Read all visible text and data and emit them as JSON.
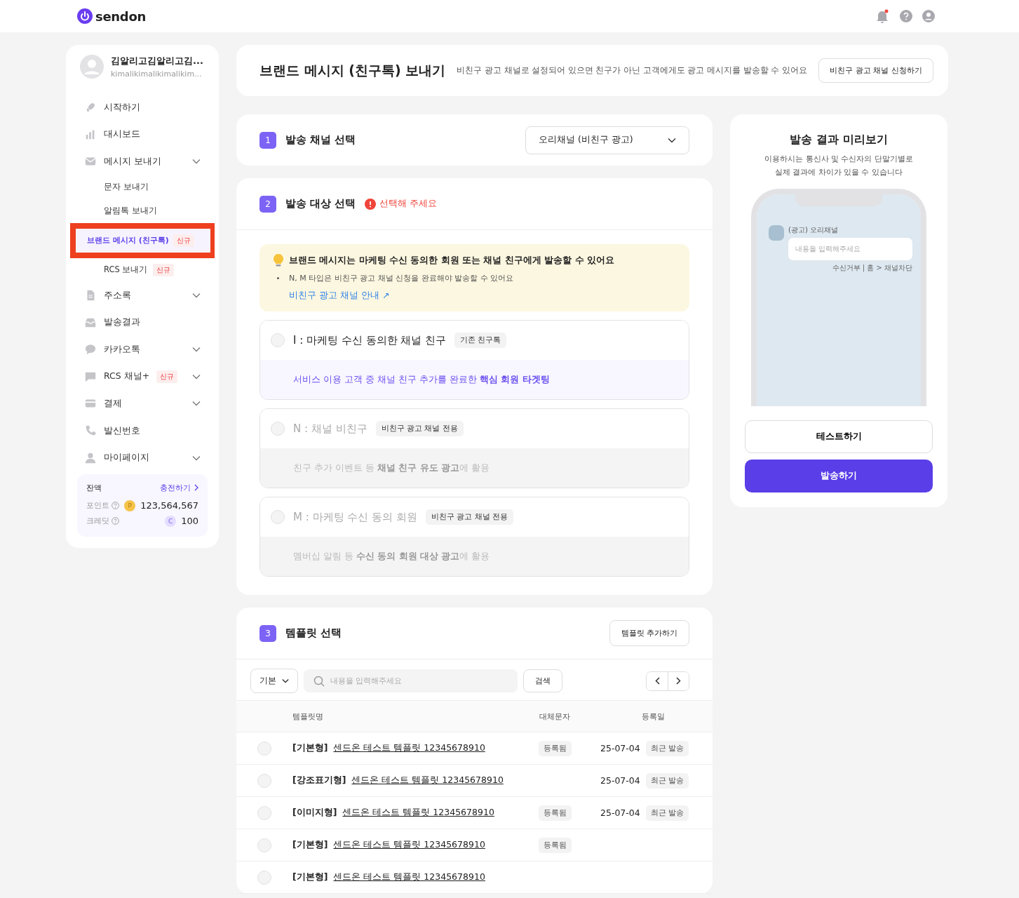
{
  "header": {
    "logo": "sendon",
    "has_notification": true
  },
  "sidebar": {
    "user": {
      "name": "김알리고김알리고김...",
      "email": "kimalikimalikimalikim..."
    },
    "nav": [
      {
        "label": "시작하기",
        "expandable": false,
        "selected": false
      },
      {
        "label": "대시보드",
        "expandable": false,
        "selected": false
      },
      {
        "label": "메시지 보내기",
        "expandable": true,
        "selected": false,
        "children": [
          {
            "label": "문자 보내기",
            "selected": false,
            "highlighted": false
          },
          {
            "label": "알림톡 보내기",
            "selected": false,
            "highlighted": false
          },
          {
            "label": "브랜드 메시지 (친구톡)",
            "badge": "신규",
            "selected": true,
            "highlighted": true
          },
          {
            "label": "RCS 보내기",
            "badge": "신규",
            "selected": false,
            "highlighted": false
          }
        ]
      },
      {
        "label": "주소록",
        "expandable": true,
        "selected": false
      },
      {
        "label": "발송결과",
        "expandable": false,
        "selected": false
      },
      {
        "label": "카카오톡",
        "expandable": true,
        "selected": false
      },
      {
        "label": "RCS 채널+",
        "badge": "신규",
        "expandable": true,
        "selected": false
      },
      {
        "label": "결제",
        "expandable": true,
        "selected": false
      },
      {
        "label": "발신번호",
        "expandable": false,
        "selected": false
      },
      {
        "label": "마이페이지",
        "expandable": true,
        "selected": false
      }
    ],
    "balance": {
      "title": "잔액",
      "charge_link": "충전하기",
      "rows": [
        {
          "label": "포인트",
          "coin": "P",
          "value": "123,564,567",
          "kind": "point"
        },
        {
          "label": "크레딧",
          "coin": "C",
          "value": "100",
          "kind": "credit"
        }
      ]
    }
  },
  "title_card": {
    "title": "브랜드 메시지 (친구톡) 보내기",
    "description": "비친구 광고 채널로 설정되어 있으면 친구가 아닌 고객에게도 광고 메시지를 발송할 수 있어요",
    "button": "비친구 광고 채널 신청하기"
  },
  "step1": {
    "number": "1",
    "title": "발송 채널 선택",
    "dropdown": "오리채널 (비친구 광고)"
  },
  "step2": {
    "number": "2",
    "title": "발송 대상 선택",
    "error": "선택해 주세요",
    "notice": {
      "title": "브랜드 메시지는 마케팅 수신 동의한 회원 또는 채널 친구에게 발송할 수 있어요",
      "bullets": [
        "N, M 타입은 비친구 광고 채널 신청을 완료해야 발송할 수 있어요"
      ],
      "link": "비친구 광고 채널 안내 ↗"
    },
    "options": [
      {
        "title": "I : 마케팅 수신 동의한 채널 친구",
        "tag": "기존 친구톡",
        "description": "서비스 이용 고객 중 채널 친구 추가를 완료한  **핵심 회원 타겟팅**",
        "disabled": false,
        "selected": false
      },
      {
        "title": "N : 채널 비친구",
        "tag": "비친구 광고 채널 전용",
        "description": "친구 추가 이벤트 등 **채널 친구 유도 광고**에 활용",
        "disabled": true,
        "selected": false
      },
      {
        "title": "M : 마케팅 수신 동의 회원",
        "tag": "비친구 광고 채널 전용",
        "description": "멤버십 알림 등 **수신 동의 회원 대상 광고**에 활용",
        "disabled": true,
        "selected": false
      }
    ]
  },
  "step3": {
    "number": "3",
    "title": "템플릿 선택",
    "add_button": "템플릿 추가하기",
    "filter": "기본",
    "search_placeholder": "내용을 입력해주세요",
    "search_button": "검색",
    "columns": [
      "템플릿명",
      "대체문자",
      "등록일"
    ],
    "rows": [
      {
        "type": "[기본형]",
        "name": "센드온 테스트 템플릿 12345678910",
        "substitute": "등록됨",
        "date": "25-07-04",
        "recent": "최근 발송",
        "selected": false
      },
      {
        "type": "[강조표기형]",
        "name": "센드온 테스트 템플릿 12345678910",
        "date": "25-07-04",
        "recent": "최근 발송",
        "selected": false
      },
      {
        "type": "[이미지형]",
        "name": "센드온 테스트 템플릿 12345678910",
        "substitute": "등록됨",
        "date": "25-07-04",
        "recent": "최근 발송",
        "selected": false
      },
      {
        "type": "[기본형]",
        "name": "센드온 테스트 템플릿 12345678910",
        "substitute": "등록됨",
        "selected": false
      },
      {
        "type": "[기본형]",
        "name": "센드온 테스트 템플릿 12345678910",
        "selected": false
      }
    ]
  },
  "preview": {
    "title": "발송 결과 미리보기",
    "subtitle": [
      "이용하시는 통신사 및 수신자의 단말기별로",
      "실제 결과에 차이가 있을 수 있습니다"
    ],
    "sender": "(광고) 오리채널",
    "message_placeholder": "내용을 입력해주세요",
    "footer": "수신거부 | 홈 > 채널차단",
    "test_button": "테스트하기",
    "send_button": "발송하기"
  }
}
